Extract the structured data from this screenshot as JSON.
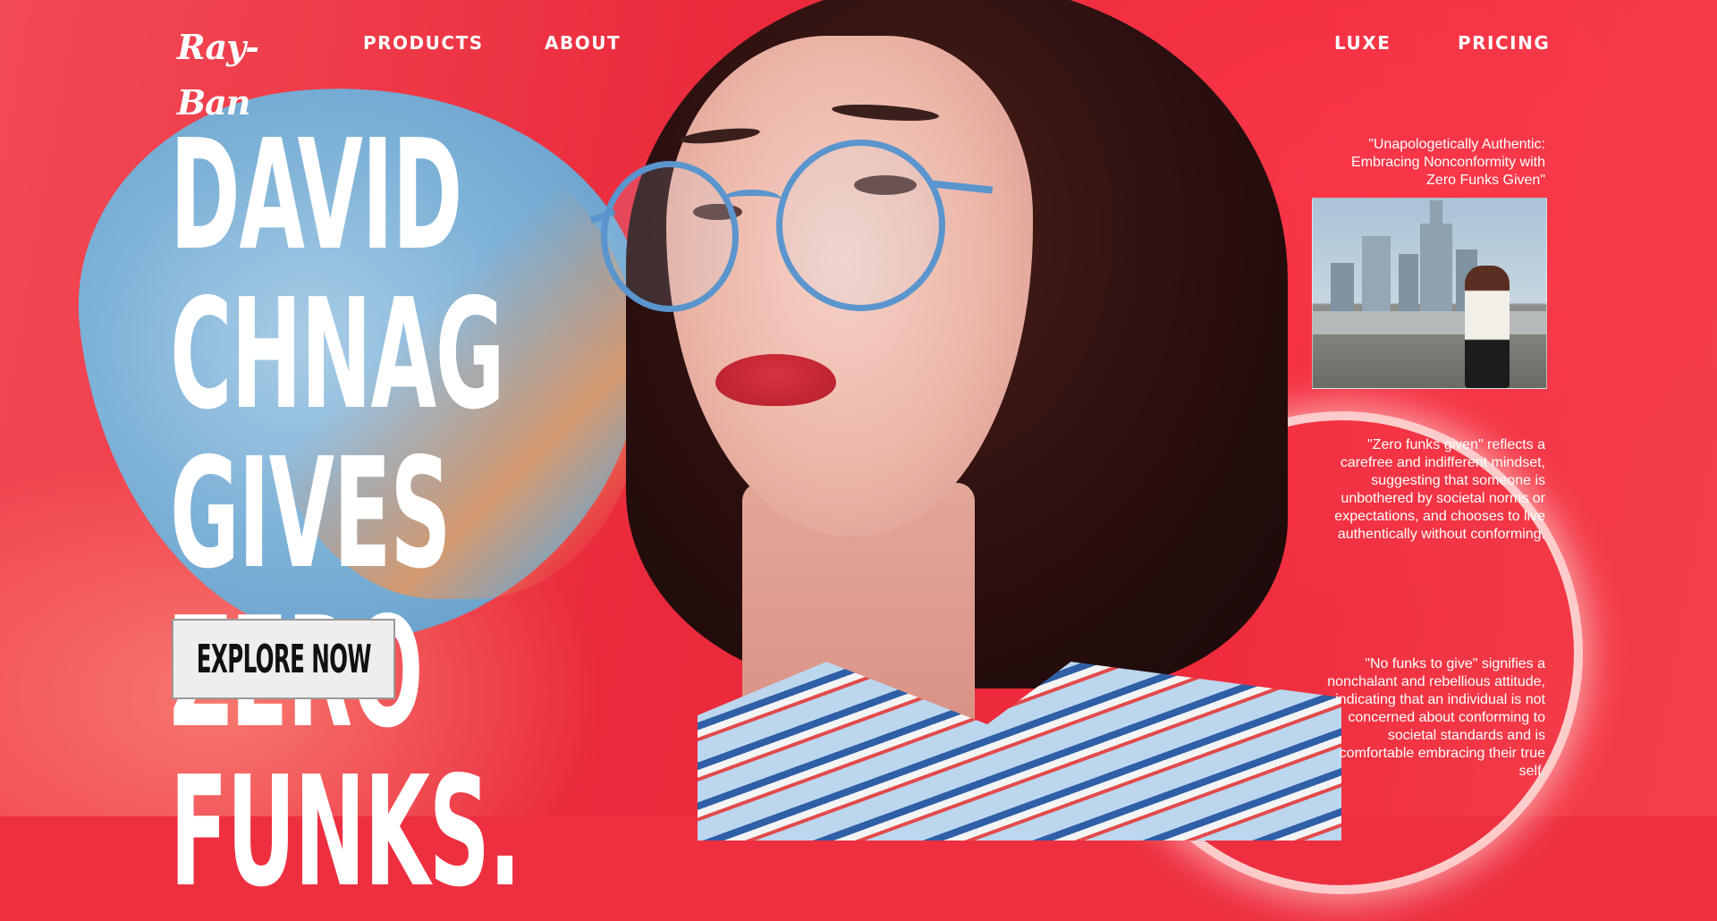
{
  "brand": {
    "logo_text": "Ray-Ban"
  },
  "nav": {
    "left": [
      "PRODUCTS",
      "ABOUT"
    ],
    "right": [
      "LUXE",
      "PRICING"
    ]
  },
  "hero": {
    "title": "DAVID CHNAG GIVES ZERO FUNKS.",
    "cta_label": "EXPLORE NOW"
  },
  "side": {
    "quote": "\"Unapologetically Authentic: Embracing Nonconformity with Zero Funks Given\"",
    "paragraph_1": "\"Zero funks given\" reflects a carefree and indifferent mindset, suggesting that someone is unbothered by societal norms or expectations, and chooses to live authentically without conforming.",
    "paragraph_2": "\"No funks to give\" signifies a nonchalant and rebellious attitude, indicating that an individual is not concerned about conforming to societal standards and is comfortable embracing their true self."
  },
  "colors": {
    "background": "#ee2f40",
    "blob": "#7eb2d8",
    "text": "#ffffff",
    "button_bg": "#eeeeee"
  },
  "icons": [
    "ray-ban-logo"
  ]
}
